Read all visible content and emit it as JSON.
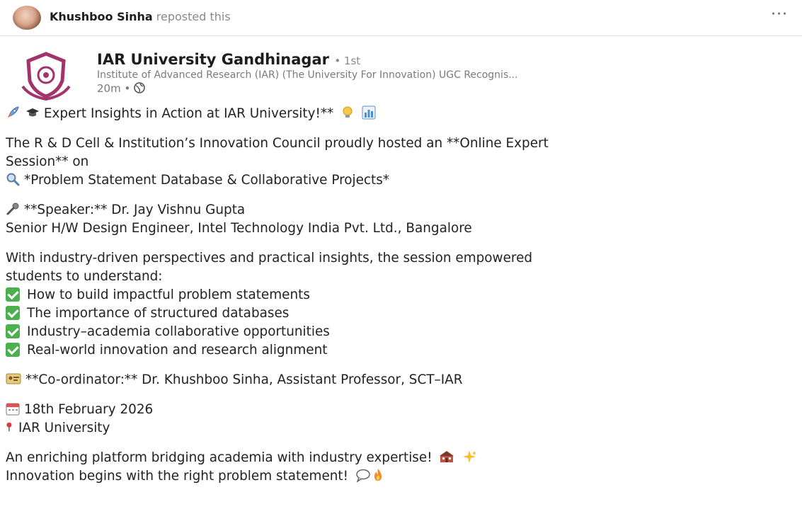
{
  "repost": {
    "name": "Khushboo Sinha",
    "action": "reposted this",
    "more_label": "···"
  },
  "org": {
    "name": "IAR University Gandhinagar",
    "degree": "• 1st",
    "subtitle": "Institute of Advanced Research (IAR) (The University For Innovation) UGC Recognis...",
    "time": "20m •",
    "logo_color": "#a3336b"
  },
  "post": {
    "headline": "Expert Insights in Action at IAR University!**",
    "intro_1": "The R & D Cell & Institution’s Innovation Council proudly hosted an **Online Expert",
    "intro_2": "Session** on",
    "topic": "*Problem Statement Database & Collaborative Projects*",
    "speaker": "**Speaker:** Dr. Jay Vishnu Gupta",
    "speaker_role": "Senior H/W Design Engineer, Intel Technology India Pvt. Ltd., Bangalore",
    "summary_1": "With industry-driven perspectives and practical insights, the session empowered",
    "summary_2": "students to understand:",
    "checklist": [
      "How to build impactful problem statements",
      "The importance of structured databases",
      "Industry–academia collaborative opportunities",
      "Real-world innovation and research alignment"
    ],
    "coordinator": "**Co-ordinator:** Dr. Khushboo Sinha, Assistant Professor, SCT–IAR",
    "date": "18th February 2026",
    "venue": "IAR University",
    "closing_1": "An enriching platform bridging academia with industry expertise!",
    "closing_2": "Innovation begins with the right problem statement!"
  },
  "icons": {
    "check_color": "#4cb04f",
    "repost_avatar": "avatar",
    "rocket": "rocket-icon",
    "graduation": "graduation-cap-icon",
    "bulb": "lightbulb-icon",
    "chart": "bar-chart-icon",
    "search": "magnifier-icon",
    "mic": "microphone-icon",
    "coordinator": "id-card-icon",
    "calendar": "calendar-icon",
    "pin": "pushpin-icon",
    "classroom": "school-icon",
    "sparkles": "sparkles-icon",
    "speech": "speech-bubble-icon",
    "fire": "fire-icon",
    "globe": "globe-icon"
  }
}
